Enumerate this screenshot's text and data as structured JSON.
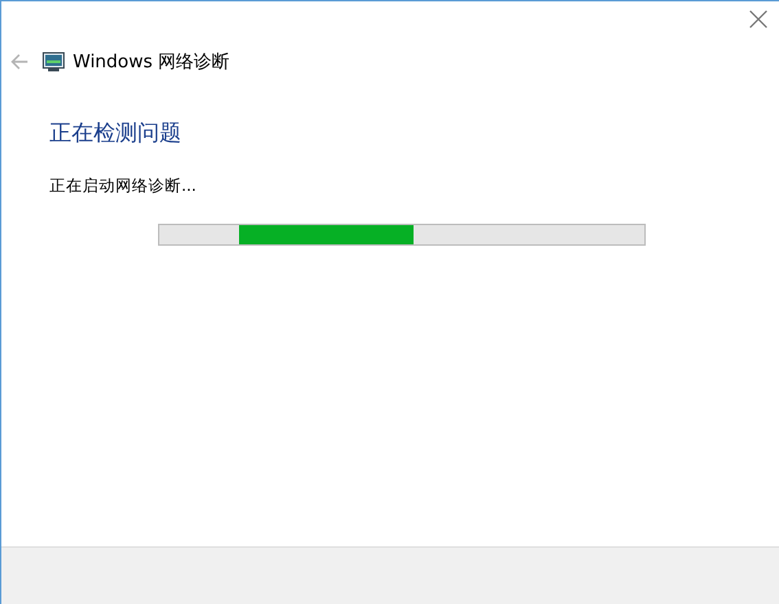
{
  "window": {
    "title": "Windows 网络诊断"
  },
  "back_button": {
    "disabled": true
  },
  "heading": "正在检测问题",
  "status": "正在启动网络诊断...",
  "progress": {
    "kind": "marquee"
  }
}
